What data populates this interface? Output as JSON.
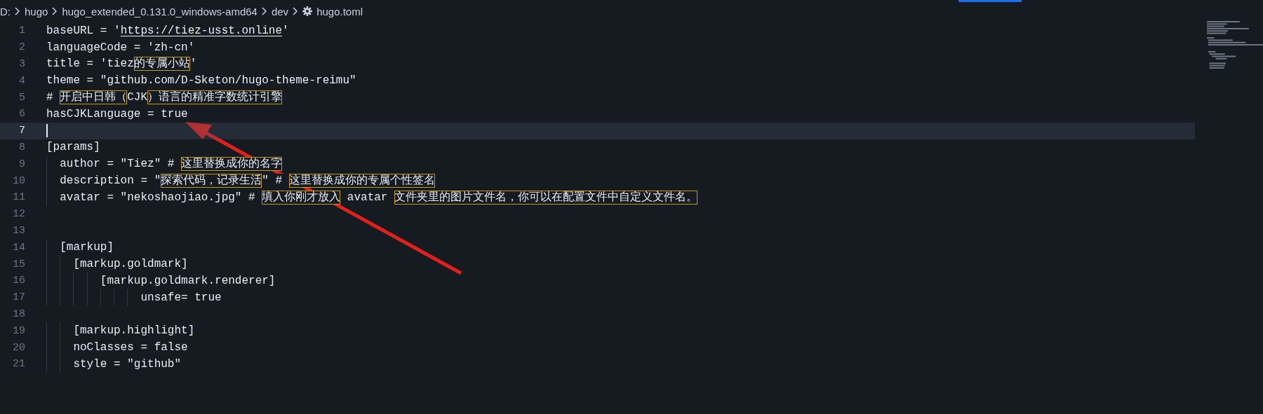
{
  "breadcrumb": [
    {
      "label": "D:",
      "kind": "folder"
    },
    {
      "label": "hugo",
      "kind": "folder"
    },
    {
      "label": "hugo_extended_0.131.0_windows-amd64",
      "kind": "folder"
    },
    {
      "label": "dev",
      "kind": "folder"
    },
    {
      "label": "hugo.toml",
      "kind": "file"
    }
  ],
  "lines": [
    {
      "number": "1",
      "current": false,
      "tokens": [
        {
          "text": "baseURL = '",
          "kind": "plain"
        },
        {
          "text": "https://tiez-usst.online",
          "kind": "link"
        },
        {
          "text": "'",
          "kind": "plain"
        }
      ]
    },
    {
      "number": "2",
      "current": false,
      "tokens": [
        {
          "text": "languageCode = 'zh-cn'",
          "kind": "plain"
        }
      ]
    },
    {
      "number": "3",
      "current": false,
      "tokens": [
        {
          "text": "title = 'tiez",
          "kind": "plain"
        },
        {
          "text": "的专属小站",
          "kind": "highlight"
        },
        {
          "text": "'",
          "kind": "plain"
        }
      ]
    },
    {
      "number": "4",
      "current": false,
      "tokens": [
        {
          "text": "theme = \"github.com/D-Sketon/hugo-theme-reimu\"",
          "kind": "plain"
        }
      ]
    },
    {
      "number": "5",
      "current": false,
      "tokens": [
        {
          "text": "# ",
          "kind": "plain"
        },
        {
          "text": "开启中日韩（",
          "kind": "highlight"
        },
        {
          "text": "CJK",
          "kind": "plain"
        },
        {
          "text": "）语言的精准字数统计引擎",
          "kind": "highlight"
        }
      ]
    },
    {
      "number": "6",
      "current": false,
      "tokens": [
        {
          "text": "hasCJKLanguage = true",
          "kind": "plain"
        }
      ]
    },
    {
      "number": "7",
      "current": true
    },
    {
      "number": "8",
      "current": false,
      "tokens": [
        {
          "text": "[params]",
          "kind": "plain"
        }
      ]
    },
    {
      "number": "9",
      "current": false,
      "tokens": [
        {
          "text": "  author = \"Tiez\" # ",
          "kind": "plain"
        },
        {
          "text": "这里替换成你的名字",
          "kind": "highlight"
        }
      ]
    },
    {
      "number": "10",
      "current": false,
      "tokens": [
        {
          "text": "  description = \"",
          "kind": "plain"
        },
        {
          "text": "探索代码，记录生活",
          "kind": "highlight"
        },
        {
          "text": "\" # ",
          "kind": "plain"
        },
        {
          "text": "这里替换成你的专属个性签名",
          "kind": "highlight"
        }
      ]
    },
    {
      "number": "11",
      "current": false,
      "tokens": [
        {
          "text": "  avatar = \"nekoshaojiao.jpg\" # ",
          "kind": "plain"
        },
        {
          "text": "填入你刚才放入",
          "kind": "highlight"
        },
        {
          "text": " avatar ",
          "kind": "plain"
        },
        {
          "text": "文件夹里的图片文件名，你可以在配置文件中自定义文件名。",
          "kind": "highlight"
        }
      ]
    },
    {
      "number": "12",
      "current": false
    },
    {
      "number": "13",
      "current": false
    },
    {
      "number": "14",
      "current": false,
      "tokens": [
        {
          "text": "  [markup]",
          "kind": "plain"
        }
      ]
    },
    {
      "number": "15",
      "current": false,
      "tokens": [
        {
          "text": "    [markup.goldmark]",
          "kind": "plain"
        }
      ]
    },
    {
      "number": "16",
      "current": false,
      "tokens": [
        {
          "text": "        [markup.goldmark.renderer]",
          "kind": "plain"
        }
      ]
    },
    {
      "number": "17",
      "current": false,
      "tokens": [
        {
          "text": "              unsafe= true",
          "kind": "plain"
        }
      ]
    },
    {
      "number": "18",
      "current": false
    },
    {
      "number": "19",
      "current": false,
      "tokens": [
        {
          "text": "    [markup.highlight]",
          "kind": "plain"
        }
      ]
    },
    {
      "number": "20",
      "current": false,
      "tokens": [
        {
          "text": "    noClasses = false",
          "kind": "plain"
        }
      ]
    },
    {
      "number": "21",
      "current": false,
      "tokens": [
        {
          "text": "    style = \"github\"",
          "kind": "plain"
        }
      ]
    }
  ],
  "annotation": {
    "kind": "arrow"
  }
}
